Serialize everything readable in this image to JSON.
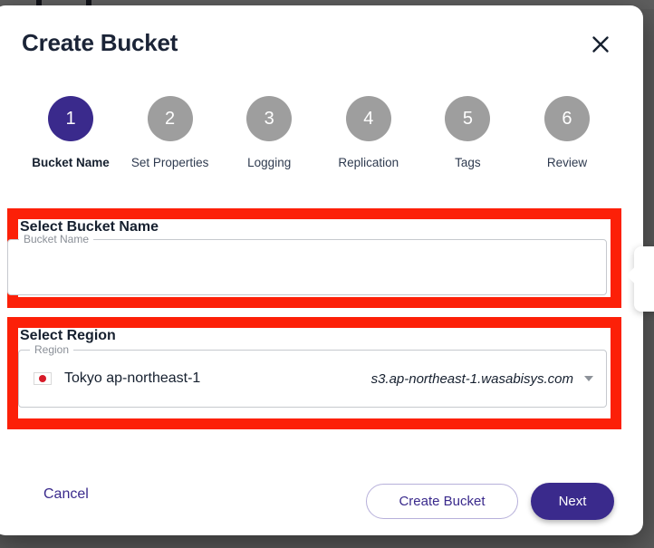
{
  "dialog": {
    "title": "Create Bucket",
    "close_icon": "close-icon"
  },
  "stepper": {
    "steps": [
      {
        "number": "1",
        "label": "Bucket Name",
        "active": true
      },
      {
        "number": "2",
        "label": "Set Properties",
        "active": false
      },
      {
        "number": "3",
        "label": "Logging",
        "active": false
      },
      {
        "number": "4",
        "label": "Replication",
        "active": false
      },
      {
        "number": "5",
        "label": "Tags",
        "active": false
      },
      {
        "number": "6",
        "label": "Review",
        "active": false
      }
    ]
  },
  "bucket_name_section": {
    "heading": "Select Bucket Name",
    "field_label": "Bucket Name",
    "value": "",
    "placeholder": ""
  },
  "region_section": {
    "heading": "Select Region",
    "field_label": "Region",
    "selected_region": "Tokyo ap-northeast-1",
    "selected_endpoint": "s3.ap-northeast-1.wasabisys.com",
    "flag_icon": "japan-flag-icon",
    "caret_icon": "chevron-down-icon"
  },
  "footer": {
    "cancel_label": "Cancel",
    "create_bucket_label": "Create Bucket",
    "next_label": "Next"
  },
  "colors": {
    "accent_purple": "#3a2a8c",
    "inactive_gray": "#9e9e9e",
    "highlight_red": "#fc2008",
    "heading_navy": "#16202f",
    "flag_red": "#d71a28"
  }
}
